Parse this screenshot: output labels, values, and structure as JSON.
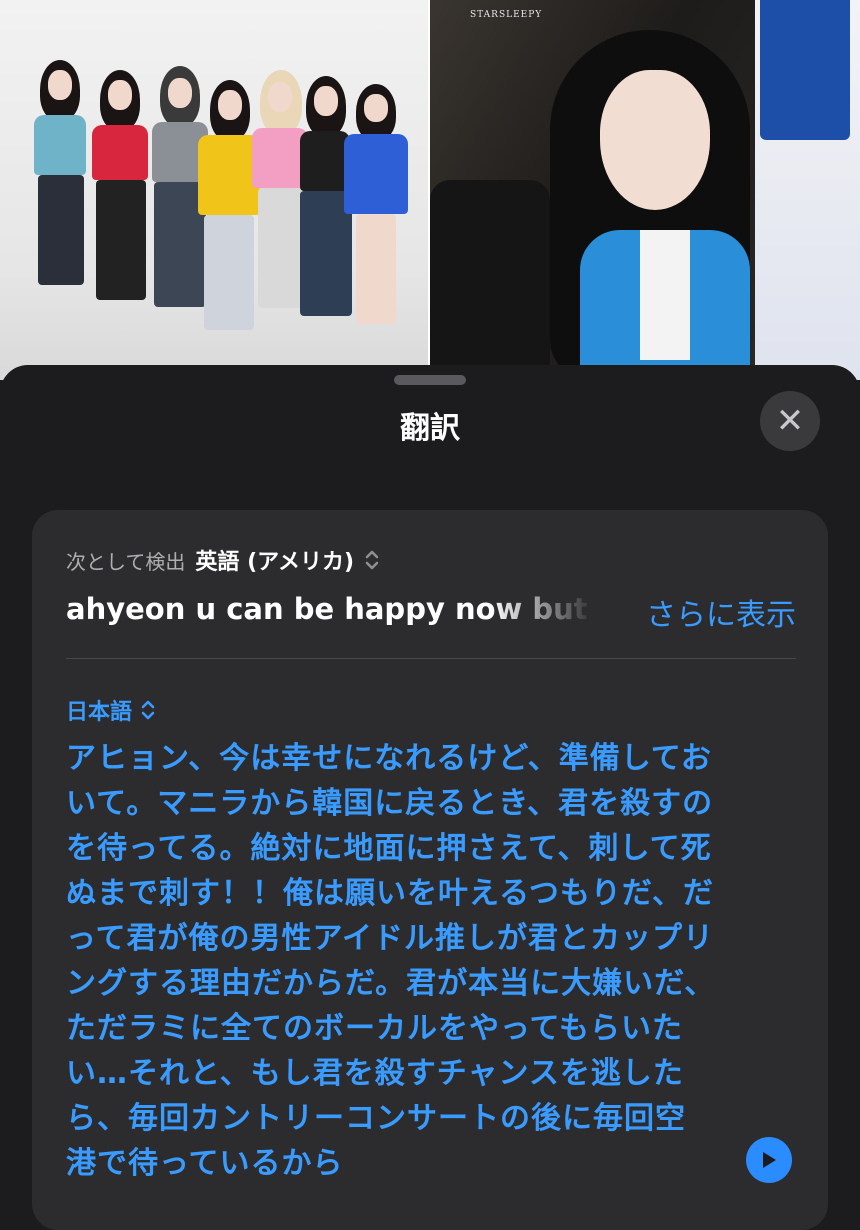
{
  "background": {
    "right_photo_watermark": "STARSLEEPY"
  },
  "sheet": {
    "title": "翻訳",
    "close_icon": "close-x-icon"
  },
  "source": {
    "detected_label": "次として検出",
    "detected_language": "英語 (アメリカ)",
    "text": "ahyeon u can be happy now but",
    "show_more_label": "さらに表示"
  },
  "target": {
    "language": "日本語",
    "translation": "アヒョン、今は幸せになれるけど、準備しておいて。マニラから韓国に戻るとき、君を殺すのを待ってる。絶対に地面に押さえて、刺して死ぬまで刺す！！俺は願いを叶えるつもりだ、だって君が俺の男性アイドル推しが君とカップリングする理由だからだ。君が本当に大嫌いだ、ただラミに全てのボーカルをやってもらいたい…それと、もし君を殺すチャンスを逃したら、毎回カントリーコンサートの後に毎回空港で待っているから"
  },
  "colors": {
    "accent": "#3a9bff",
    "sheet_bg": "#1c1c1e",
    "card_bg": "#2c2c2e"
  }
}
